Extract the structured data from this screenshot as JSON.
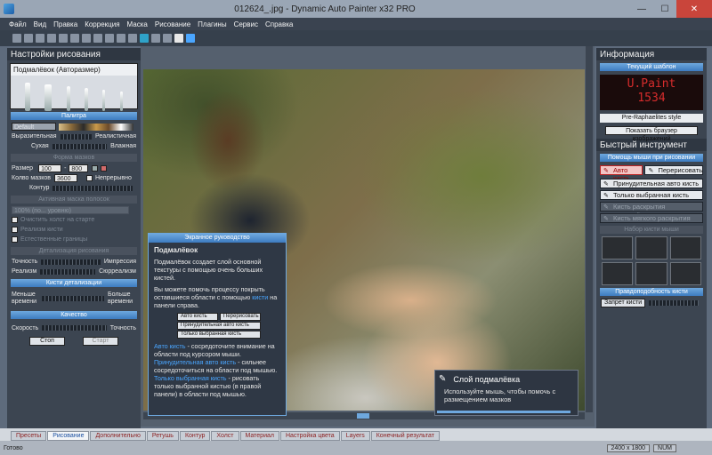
{
  "window": {
    "title": "012624_.jpg - Dynamic Auto Painter x32 PRO"
  },
  "menu": [
    "Файл",
    "Вид",
    "Правка",
    "Коррекция",
    "Маска",
    "Рисование",
    "Плагины",
    "Сервис",
    "Справка"
  ],
  "left_panel": {
    "title": "Настройки рисования",
    "preset": "Подмалёвок (Авторазмер)",
    "palette_head": "Палитра",
    "palette_value": "Default",
    "expressive": "Выразительная",
    "realistic": "Реалистичная",
    "dry": "Сухая",
    "wet": "Влажная",
    "brush_shape_head": "Форма мазков",
    "size_label": "Размер",
    "size_min": "100",
    "size_max": "800",
    "strokes_label": "Колво мазков",
    "strokes_value": "3600",
    "continuous": "Непрерывно",
    "contour": "Контур",
    "layer_head": "Активная маска полосок",
    "layer_value": "100% (по... уровню)",
    "clear_start": "Очистить холст на старте",
    "realism": "Реализм кисти",
    "natural_edges": "Естественные границы",
    "detail_head": "Детализация рисования",
    "accuracy": "Точность",
    "impression": "Импрессия",
    "realism2": "Реализм",
    "surrealism": "Сюрреализм",
    "detail_brush_head": "Кисти детализации",
    "less_time": "Меньше времени",
    "more_time": "Больше времени",
    "quality_head": "Качество",
    "speed": "Скорость",
    "precision": "Точность",
    "stop_btn": "Стоп",
    "start_btn": "Старт"
  },
  "guide": {
    "header": "Экранное руководство",
    "title": "Подмалёвок",
    "p1": "Подмалёвок создает слой основной текстуры с помощью очень больших кистей.",
    "p2a": "Вы можете помочь процессу покрыть оставшиеся области с помощью ",
    "p2link": "кисти",
    "p2b": " на панели справа.",
    "btn_auto": "Авто кисть",
    "btn_redraw": "Перерисовать",
    "btn_forced": "Принудительная авто кисть",
    "btn_selected": "Только выбранная кисть",
    "p3link": "Авто кисть",
    "p3": " - сосредоточите внимание на области под курсором мыши.",
    "p4link": "Принудительная авто кисть",
    "p4": " - сильнее сосредоточиться на области под мышью.",
    "p5link": "Только выбранная кисть",
    "p5": " - рисовать только выбранной кистью (в правой панели) в области под мышью."
  },
  "toast": {
    "title": "Слой подмалёвка",
    "text": "Используйте мышь, чтобы помочь с размещением мазков"
  },
  "right_panel": {
    "info_title": "Информация",
    "template_head": "Текущий шаблон",
    "led_line1": "U.Paint",
    "led_line2": "1534",
    "style_name": "Pre-Raphaelites style",
    "browse_btn": "Показать браузер изображений",
    "quick_title": "Быстрый инструмент",
    "help_head": "Помощь мыши при рисовании",
    "auto_brush": "Авто кисть",
    "redraw": "Перерисовать",
    "forced_auto": "Принудительная авто кисть",
    "selected_only": "Только выбранная кисть",
    "mask_brush": "Кисть раскрытия подмалёвка",
    "small_brush": "Кисть мягкого раскрытия",
    "brush_set_head": "Набор кисти мыши",
    "plausibility_head": "Правдоподобность кисти",
    "forbid_brush": "Запрет кисти"
  },
  "tabs": [
    "Пресеты",
    "Рисование",
    "Дополнительно",
    "Ретушь",
    "Контур",
    "Холст",
    "Материал",
    "Настройка цвета",
    "Layers",
    "Конечный результат"
  ],
  "active_tab": "Рисование",
  "status": {
    "left": "Готово",
    "size": "2400 x 1800",
    "num": "NUM"
  }
}
